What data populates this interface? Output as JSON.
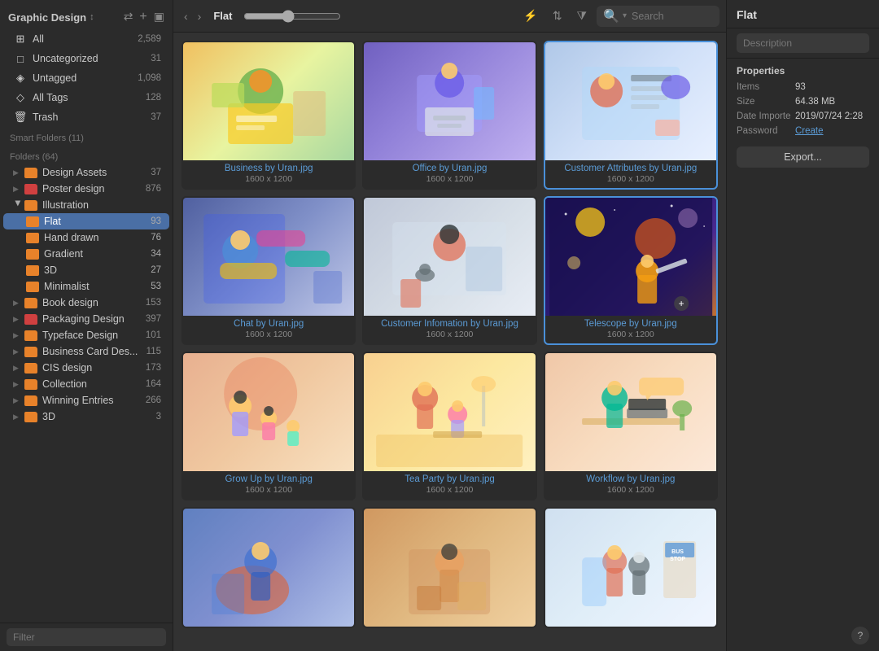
{
  "sidebar": {
    "title": "Graphic Design",
    "title_icon": "↕",
    "smart_folders_label": "Smart Folders (11)",
    "folders_label": "Folders (64)",
    "all_items": [
      {
        "icon": "⊞",
        "label": "All",
        "count": "2,589"
      },
      {
        "icon": "□",
        "label": "Uncategorized",
        "count": "31"
      },
      {
        "icon": "◈",
        "label": "Untagged",
        "count": "1,098"
      },
      {
        "icon": "◇",
        "label": "All Tags",
        "count": "128"
      },
      {
        "icon": "🗑",
        "label": "Trash",
        "count": "37"
      }
    ],
    "folders": [
      {
        "label": "Design Assets",
        "count": "37",
        "color": "dot-orange"
      },
      {
        "label": "Poster design",
        "count": "876",
        "color": "dot-red"
      }
    ],
    "illustration": {
      "label": "Illustration",
      "color": "dot-orange",
      "children": [
        {
          "label": "Flat",
          "count": "93",
          "color": "#e8822a"
        },
        {
          "label": "Hand drawn",
          "count": "76",
          "color": "#e8822a"
        },
        {
          "label": "Gradient",
          "count": "34",
          "color": "#e8822a"
        },
        {
          "label": "3D",
          "count": "27",
          "color": "#e8822a"
        },
        {
          "label": "Minimalist",
          "count": "53",
          "color": "#e8822a"
        }
      ]
    },
    "more_folders": [
      {
        "label": "Book design",
        "count": "153",
        "color": "dot-orange"
      },
      {
        "label": "Packaging Design",
        "count": "397",
        "color": "dot-red"
      },
      {
        "label": "Typeface Design",
        "count": "101",
        "color": "dot-orange"
      },
      {
        "label": "Business Card Des...",
        "count": "115",
        "color": "dot-orange"
      },
      {
        "label": "CIS design",
        "count": "173",
        "color": "dot-orange"
      },
      {
        "label": "Collection",
        "count": "164",
        "color": "dot-orange"
      },
      {
        "label": "Winning Entries",
        "count": "266",
        "color": "dot-orange"
      },
      {
        "label": "3D",
        "count": "3",
        "color": "dot-orange"
      }
    ],
    "filter_placeholder": "Filter"
  },
  "toolbar": {
    "back_label": "‹",
    "forward_label": "›",
    "breadcrumb": "Flat",
    "search_placeholder": "Search",
    "search_icon": "🔍"
  },
  "grid": {
    "items": [
      {
        "id": 1,
        "title": "Business by Uran.jpg",
        "dims": "1600 x 1200",
        "bg": "bg-business",
        "selected": false
      },
      {
        "id": 2,
        "title": "Office by Uran.jpg",
        "dims": "1600 x 1200",
        "bg": "bg-office",
        "selected": false
      },
      {
        "id": 3,
        "title": "Customer Attributes by Uran.jpg",
        "dims": "1600 x 1200",
        "bg": "bg-customer",
        "selected": true
      },
      {
        "id": 4,
        "title": "Chat by Uran.jpg",
        "dims": "1600 x 1200",
        "bg": "bg-chat",
        "selected": false
      },
      {
        "id": 5,
        "title": "Customer Infomation by Uran.jpg",
        "dims": "1600 x 1200",
        "bg": "bg-customer-info",
        "selected": false
      },
      {
        "id": 6,
        "title": "Telescope by Uran.jpg",
        "dims": "1600 x 1200",
        "bg": "bg-telescope",
        "selected": true
      },
      {
        "id": 7,
        "title": "Grow Up by Uran.jpg",
        "dims": "1600 x 1200",
        "bg": "bg-growup",
        "selected": false
      },
      {
        "id": 8,
        "title": "Tea Party by Uran.jpg",
        "dims": "1600 x 1200",
        "bg": "bg-teaparty",
        "selected": false
      },
      {
        "id": 9,
        "title": "Workflow by Uran.jpg",
        "dims": "1600 x 1200",
        "bg": "bg-workflow",
        "selected": false
      },
      {
        "id": 10,
        "title": "",
        "dims": "",
        "bg": "bg-row4a",
        "selected": false
      },
      {
        "id": 11,
        "title": "",
        "dims": "",
        "bg": "bg-row4b",
        "selected": false
      },
      {
        "id": 12,
        "title": "",
        "dims": "",
        "bg": "bg-row4c",
        "selected": false
      }
    ]
  },
  "detail": {
    "title": "Flat",
    "description_placeholder": "Description",
    "properties_label": "Properties",
    "items_key": "Items",
    "items_val": "93",
    "size_key": "Size",
    "size_val": "64.38 MB",
    "date_key": "Date Importe",
    "date_val": "2019/07/24 2:28",
    "password_key": "Password",
    "password_link": "Create",
    "export_label": "Export...",
    "help_label": "?"
  }
}
